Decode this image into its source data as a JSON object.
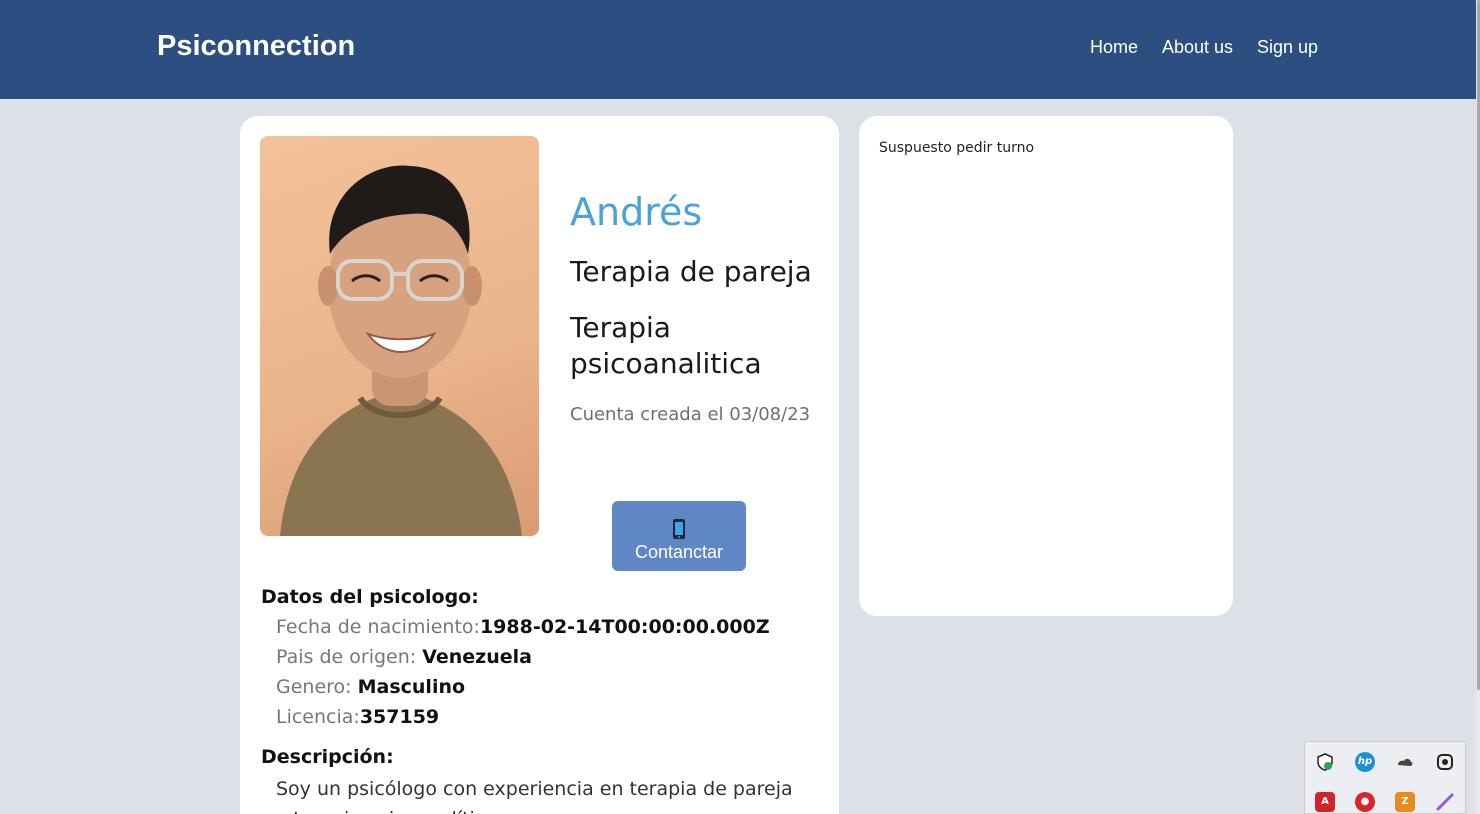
{
  "header": {
    "brand": "Psiconnection",
    "nav": [
      "Home",
      "About us",
      "Sign up"
    ]
  },
  "profile": {
    "name": "Andrés",
    "specialties": [
      "Terapia de pareja",
      "Terapia psicoanalitica"
    ],
    "created": "Cuenta creada el 03/08/23",
    "contact_label": "Contanctar",
    "contact_icon": "phone-icon"
  },
  "details": {
    "title": "Datos del psicologo:",
    "rows": [
      {
        "label": "Fecha de nacimiento:",
        "value": "1988-02-14T00:00:00.000Z"
      },
      {
        "label": "Pais de origen: ",
        "value": "Venezuela"
      },
      {
        "label": "Genero: ",
        "value": "Masculino"
      },
      {
        "label": "Licencia:",
        "value": "357159"
      }
    ]
  },
  "description": {
    "title": "Descripción:",
    "text": "Soy un psicólogo con experiencia en terapia de pareja y terapia psicoanalítica."
  },
  "sidebar": {
    "text": "Suspuesto pedir turno"
  },
  "system_tray": {
    "icons": [
      "shield-icon",
      "hp-icon",
      "cloud-sync-icon",
      "openvpn-icon",
      "pdf-icon",
      "record-icon",
      "archive-icon",
      "pen-icon"
    ]
  },
  "colors": {
    "navbar": "#2c4e80",
    "accent_name": "#4aa3d8",
    "button": "#5f87c6",
    "background": "#dde0e7"
  }
}
